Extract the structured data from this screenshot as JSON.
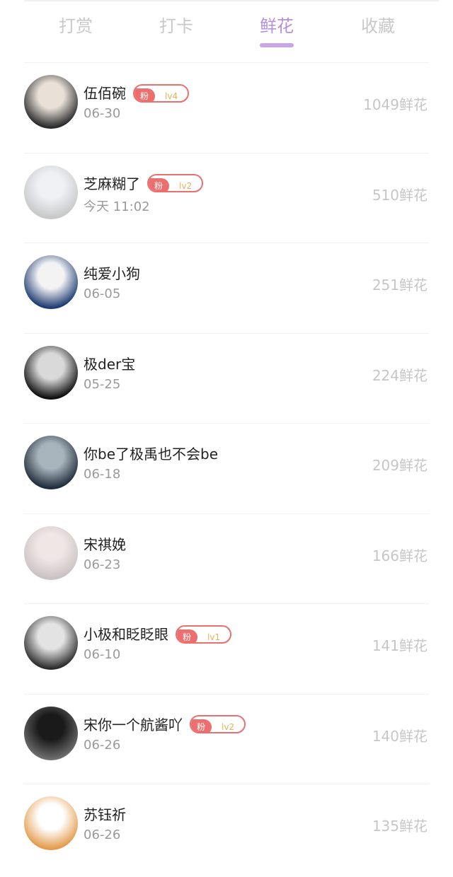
{
  "tabs": [
    {
      "label": "打赏",
      "active": false
    },
    {
      "label": "打卡",
      "active": false
    },
    {
      "label": "鲜花",
      "active": true
    },
    {
      "label": "收藏",
      "active": false
    }
  ],
  "badge_fan_label": "粉",
  "rows": [
    {
      "name": "伍佰碗",
      "date": "06-30",
      "level": "lv4",
      "count": "1049鲜花",
      "avatar_colors": [
        "#e8e1d8",
        "#2a2a2a"
      ]
    },
    {
      "name": "芝麻糊了",
      "date": "今天 11:02",
      "level": "lv2",
      "count": "510鲜花",
      "avatar_colors": [
        "#eef0f4",
        "#c8c8c8"
      ]
    },
    {
      "name": "纯爱小狗",
      "date": "06-05",
      "level": "",
      "count": "251鲜花",
      "avatar_colors": [
        "#f3f3f3",
        "#1d3a72"
      ]
    },
    {
      "name": "极der宝",
      "date": "05-25",
      "level": "",
      "count": "224鲜花",
      "avatar_colors": [
        "#d9d9d9",
        "#0e0e0e"
      ]
    },
    {
      "name": "你be了极禹也不会be",
      "date": "06-18",
      "level": "",
      "count": "209鲜花",
      "avatar_colors": [
        "#a8b4bc",
        "#1f2c3a"
      ]
    },
    {
      "name": "宋祺娩",
      "date": "06-23",
      "level": "",
      "count": "166鲜花",
      "avatar_colors": [
        "#f1e6e6",
        "#c9c2c4"
      ]
    },
    {
      "name": "小极和眨眨眼",
      "date": "06-10",
      "level": "lv1",
      "count": "141鲜花",
      "avatar_colors": [
        "#e3e3e3",
        "#2b2b2b"
      ]
    },
    {
      "name": "宋你一个航酱吖",
      "date": "06-26",
      "level": "lv2",
      "count": "140鲜花",
      "avatar_colors": [
        "#1a1a1a",
        "#6d6d6d"
      ]
    },
    {
      "name": "苏钰祈",
      "date": "06-26",
      "level": "",
      "count": "135鲜花",
      "avatar_colors": [
        "#ffffff",
        "#e39b4b"
      ]
    }
  ]
}
